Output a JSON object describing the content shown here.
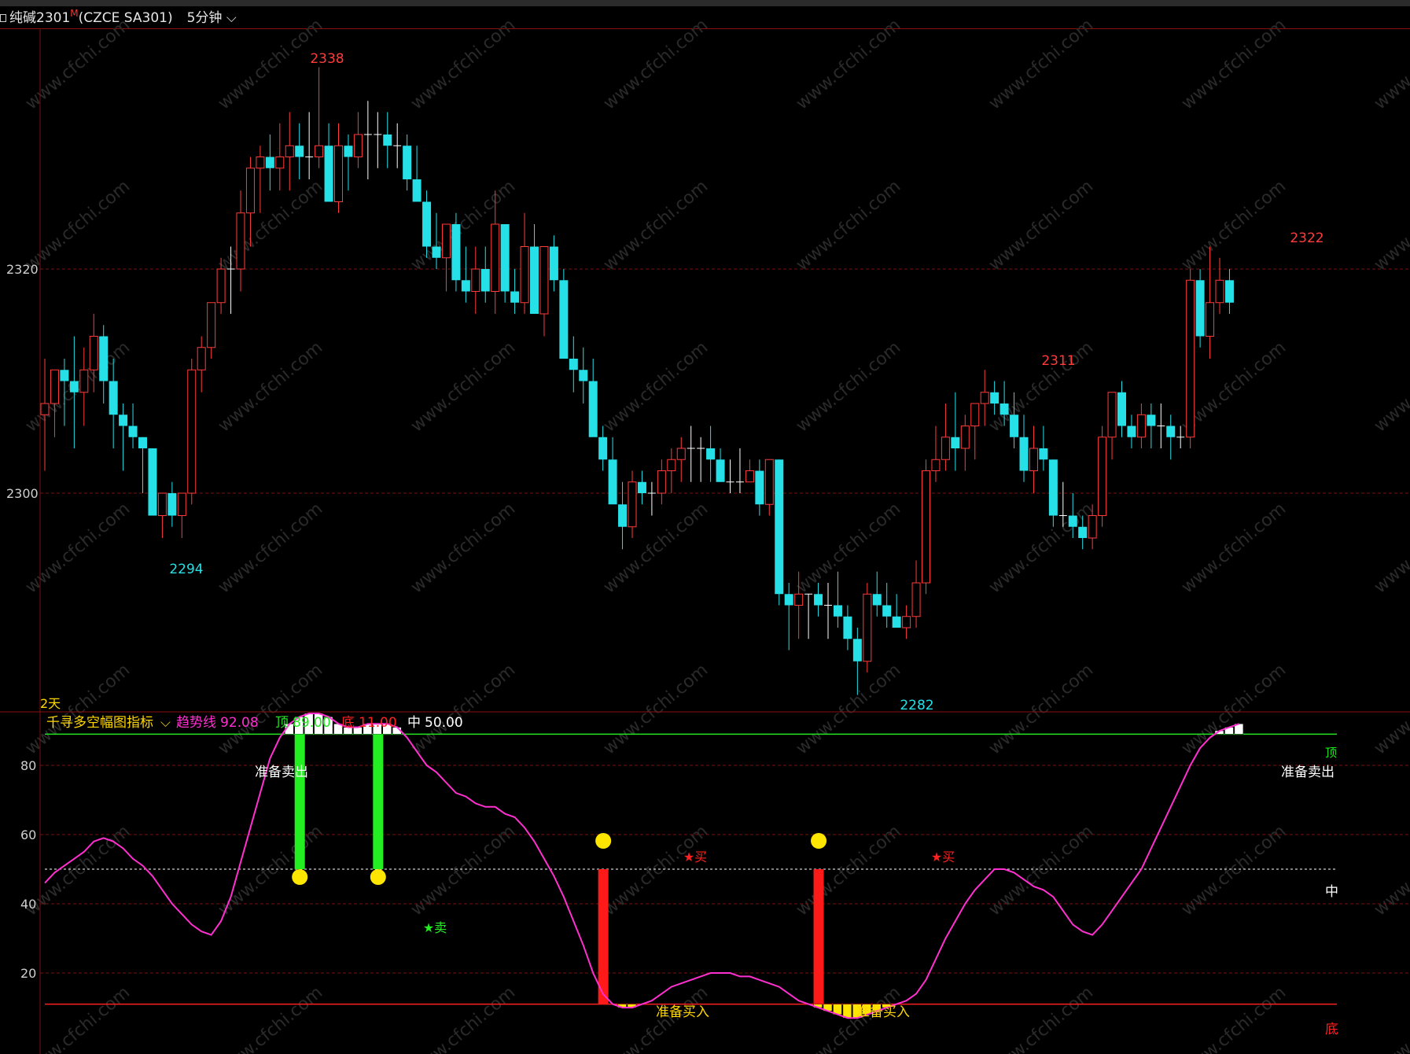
{
  "header": {
    "title": "纯碱2301",
    "marker": "M",
    "code": "(CZCE SA301)",
    "period": "5分钟"
  },
  "colors": {
    "up": "#ff3b3b",
    "down": "#26e0e8",
    "doji": "#ffffff",
    "bg": "#000000",
    "grid": "#7a1010",
    "trend": "#ff2fd0",
    "top": "#22e622",
    "bottom": "#ff2020",
    "mid": "#ffffff"
  },
  "watermark": "www.cfchi.com",
  "main": {
    "span_label": "2天",
    "y_ticks": [
      "2320",
      "2300"
    ],
    "markers": {
      "high1": "2338",
      "low1": "2294",
      "low2": "2282",
      "high2": "2311",
      "high3": "2322"
    }
  },
  "indicator": {
    "name": "千寻多空幅图指标",
    "trend_label": "趋势线",
    "trend_value": "92.08",
    "top_label": "顶",
    "top_value": "89.00",
    "bottom_label": "底",
    "bottom_value": "11.00",
    "mid_label": "中",
    "mid_value": "50.00",
    "y_ticks": [
      "80",
      "60",
      "40",
      "20"
    ],
    "line_labels": {
      "mid": "中",
      "bottom": "底",
      "top": "顶"
    },
    "signals": {
      "prepare_sell": "准备卖出",
      "prepare_buy": "准备买入",
      "sell": "★卖",
      "buy": "★买"
    }
  },
  "chart_data": [
    {
      "type": "candlestick",
      "title": "纯碱2301 (CZCE SA301) 5分钟",
      "ylim": [
        2280,
        2340
      ],
      "y_ticks": [
        2320,
        2300
      ],
      "candles": [
        [
          2307,
          2312,
          2302,
          2308
        ],
        [
          2308,
          2311,
          2305,
          2311
        ],
        [
          2311,
          2312,
          2306,
          2310
        ],
        [
          2310,
          2314,
          2304,
          2309
        ],
        [
          2309,
          2313,
          2306,
          2311
        ],
        [
          2311,
          2316,
          2309,
          2314
        ],
        [
          2314,
          2315,
          2308,
          2310
        ],
        [
          2310,
          2312,
          2304,
          2307
        ],
        [
          2307,
          2308,
          2302,
          2306
        ],
        [
          2306,
          2308,
          2304,
          2305
        ],
        [
          2305,
          2305,
          2300,
          2304
        ],
        [
          2304,
          2304,
          2298,
          2298
        ],
        [
          2298,
          2300,
          2296,
          2300
        ],
        [
          2300,
          2301,
          2297,
          2298
        ],
        [
          2298,
          2300,
          2296,
          2300
        ],
        [
          2300,
          2312,
          2299,
          2311
        ],
        [
          2311,
          2314,
          2309,
          2313
        ],
        [
          2313,
          2317,
          2312,
          2317
        ],
        [
          2317,
          2321,
          2316,
          2320
        ],
        [
          2320,
          2322,
          2316,
          2320
        ],
        [
          2320,
          2327,
          2318,
          2325
        ],
        [
          2325,
          2330,
          2322,
          2329
        ],
        [
          2329,
          2331,
          2325,
          2330
        ],
        [
          2330,
          2332,
          2327,
          2329
        ],
        [
          2329,
          2333,
          2327,
          2330
        ],
        [
          2330,
          2334,
          2327,
          2331
        ],
        [
          2331,
          2333,
          2328,
          2330
        ],
        [
          2330,
          2334,
          2328,
          2330
        ],
        [
          2330,
          2338,
          2329,
          2331
        ],
        [
          2331,
          2333,
          2326,
          2326
        ],
        [
          2326,
          2333,
          2325,
          2331
        ],
        [
          2331,
          2332,
          2327,
          2330
        ],
        [
          2330,
          2334,
          2329,
          2332
        ],
        [
          2332,
          2335,
          2328,
          2332
        ],
        [
          2332,
          2334,
          2329,
          2332
        ],
        [
          2332,
          2334,
          2329,
          2331
        ],
        [
          2331,
          2333,
          2329,
          2331
        ],
        [
          2331,
          2332,
          2327,
          2328
        ],
        [
          2328,
          2331,
          2326,
          2326
        ],
        [
          2326,
          2327,
          2321,
          2322
        ],
        [
          2322,
          2325,
          2320,
          2321
        ],
        [
          2321,
          2324,
          2318,
          2324
        ],
        [
          2324,
          2325,
          2318,
          2319
        ],
        [
          2319,
          2322,
          2317,
          2318
        ],
        [
          2318,
          2322,
          2316,
          2320
        ],
        [
          2320,
          2322,
          2317,
          2318
        ],
        [
          2318,
          2327,
          2316,
          2324
        ],
        [
          2324,
          2324,
          2317,
          2318
        ],
        [
          2318,
          2320,
          2316,
          2317
        ],
        [
          2317,
          2325,
          2316,
          2322
        ],
        [
          2322,
          2324,
          2318,
          2316
        ],
        [
          2316,
          2322,
          2314,
          2322
        ],
        [
          2322,
          2323,
          2318,
          2319
        ],
        [
          2319,
          2320,
          2312,
          2312
        ],
        [
          2312,
          2314,
          2309,
          2311
        ],
        [
          2311,
          2313,
          2308,
          2310
        ],
        [
          2310,
          2312,
          2306,
          2305
        ],
        [
          2305,
          2306,
          2302,
          2303
        ],
        [
          2303,
          2305,
          2300,
          2299
        ],
        [
          2299,
          2301,
          2295,
          2297
        ],
        [
          2297,
          2302,
          2296,
          2301
        ],
        [
          2301,
          2302,
          2299,
          2300
        ],
        [
          2300,
          2301,
          2298,
          2300
        ],
        [
          2300,
          2303,
          2299,
          2302
        ],
        [
          2302,
          2304,
          2300,
          2303
        ],
        [
          2303,
          2305,
          2301,
          2304
        ],
        [
          2304,
          2306,
          2301,
          2304
        ],
        [
          2304,
          2305,
          2301,
          2304
        ],
        [
          2304,
          2306,
          2301,
          2303
        ],
        [
          2303,
          2304,
          2301,
          2301
        ],
        [
          2301,
          2303,
          2300,
          2301
        ],
        [
          2301,
          2304,
          2300,
          2301
        ],
        [
          2301,
          2303,
          2301,
          2302
        ],
        [
          2302,
          2303,
          2298,
          2299
        ],
        [
          2299,
          2303,
          2298,
          2303
        ],
        [
          2303,
          2303,
          2290,
          2291
        ],
        [
          2291,
          2292,
          2286,
          2290
        ],
        [
          2290,
          2293,
          2287,
          2291
        ],
        [
          2291,
          2291,
          2287,
          2291
        ],
        [
          2291,
          2292,
          2289,
          2290
        ],
        [
          2290,
          2292,
          2287,
          2290
        ],
        [
          2290,
          2293,
          2288,
          2289
        ],
        [
          2289,
          2290,
          2286,
          2287
        ],
        [
          2287,
          2288,
          2282,
          2285
        ],
        [
          2285,
          2292,
          2284,
          2291
        ],
        [
          2291,
          2293,
          2289,
          2290
        ],
        [
          2290,
          2292,
          2288,
          2289
        ],
        [
          2289,
          2291,
          2288,
          2288
        ],
        [
          2288,
          2290,
          2287,
          2289
        ],
        [
          2289,
          2294,
          2288,
          2292
        ],
        [
          2292,
          2303,
          2291,
          2302
        ],
        [
          2302,
          2306,
          2301,
          2303
        ],
        [
          2303,
          2308,
          2302,
          2305
        ],
        [
          2305,
          2309,
          2302,
          2304
        ],
        [
          2304,
          2307,
          2302,
          2306
        ],
        [
          2306,
          2308,
          2303,
          2308
        ],
        [
          2308,
          2311,
          2306,
          2309
        ],
        [
          2309,
          2310,
          2307,
          2308
        ],
        [
          2308,
          2310,
          2306,
          2307
        ],
        [
          2307,
          2309,
          2304,
          2305
        ],
        [
          2305,
          2307,
          2301,
          2302
        ],
        [
          2302,
          2306,
          2300,
          2304
        ],
        [
          2304,
          2306,
          2302,
          2303
        ],
        [
          2303,
          2303,
          2297,
          2298
        ],
        [
          2298,
          2301,
          2297,
          2298
        ],
        [
          2298,
          2300,
          2296,
          2297
        ],
        [
          2297,
          2298,
          2295,
          2296
        ],
        [
          2296,
          2299,
          2295,
          2298
        ],
        [
          2298,
          2306,
          2297,
          2305
        ],
        [
          2305,
          2308,
          2303,
          2309
        ],
        [
          2309,
          2310,
          2305,
          2306
        ],
        [
          2306,
          2307,
          2304,
          2305
        ],
        [
          2305,
          2308,
          2304,
          2307
        ],
        [
          2307,
          2308,
          2304,
          2306
        ],
        [
          2306,
          2308,
          2304,
          2306
        ],
        [
          2306,
          2307,
          2303,
          2305
        ],
        [
          2305,
          2306,
          2304,
          2305
        ],
        [
          2305,
          2320,
          2304,
          2319
        ],
        [
          2319,
          2320,
          2313,
          2314
        ],
        [
          2314,
          2322,
          2312,
          2317
        ],
        [
          2317,
          2321,
          2316,
          2319
        ],
        [
          2319,
          2320,
          2316,
          2317
        ]
      ]
    },
    {
      "type": "line",
      "title": "千寻多空幅图指标",
      "ylim": [
        0,
        100
      ],
      "y_ticks": [
        80,
        60,
        40,
        20
      ],
      "reference_lines": {
        "top": 89,
        "mid": 50,
        "bottom": 11
      },
      "series": [
        {
          "name": "趋势线",
          "values": [
            46,
            49,
            51,
            53,
            55,
            58,
            59,
            58,
            56,
            53,
            51,
            48,
            44,
            40,
            37,
            34,
            32,
            31,
            35,
            42,
            52,
            62,
            72,
            82,
            88,
            92,
            94,
            95,
            95,
            94,
            92,
            91,
            91,
            92,
            92,
            92,
            91,
            88,
            84,
            80,
            78,
            75,
            72,
            71,
            69,
            68,
            68,
            66,
            65,
            62,
            58,
            53,
            48,
            42,
            35,
            28,
            20,
            14,
            11,
            10,
            10,
            11,
            12,
            14,
            16,
            17,
            18,
            19,
            20,
            20,
            20,
            19,
            19,
            18,
            17,
            16,
            14,
            12,
            11,
            10,
            9,
            8,
            7,
            7,
            8,
            9,
            10,
            11,
            12,
            14,
            18,
            24,
            30,
            35,
            40,
            44,
            47,
            50,
            50,
            49,
            47,
            45,
            44,
            42,
            38,
            34,
            32,
            31,
            34,
            38,
            42,
            46,
            50,
            56,
            62,
            68,
            74,
            80,
            85,
            88,
            90,
            91,
            92
          ]
        }
      ]
    }
  ]
}
